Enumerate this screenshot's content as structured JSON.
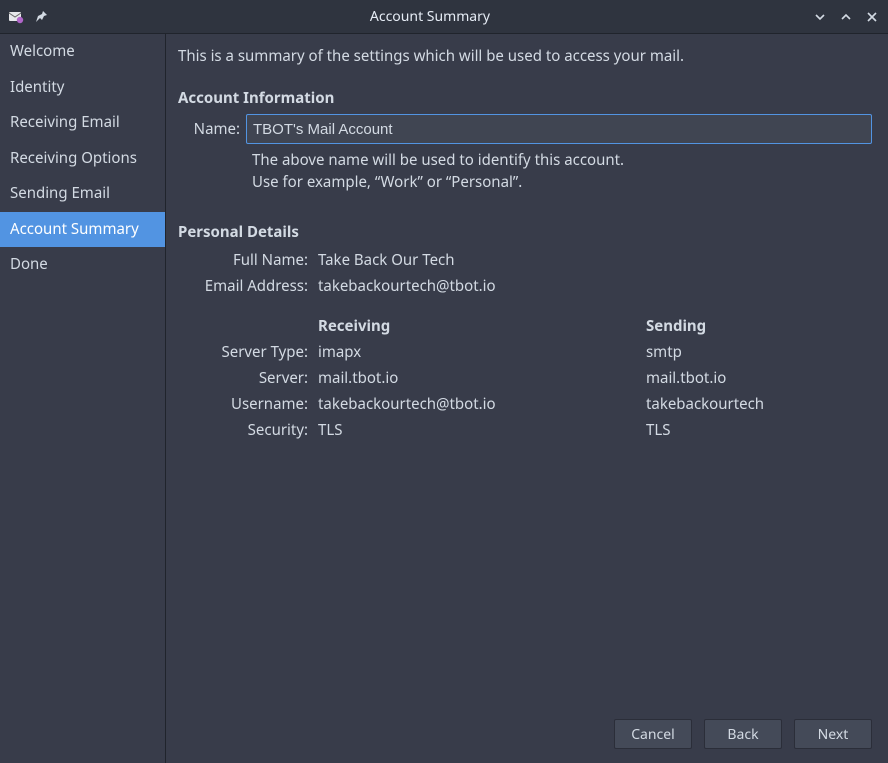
{
  "titlebar": {
    "title": "Account Summary"
  },
  "sidebar": {
    "items": [
      {
        "label": "Welcome"
      },
      {
        "label": "Identity"
      },
      {
        "label": "Receiving Email"
      },
      {
        "label": "Receiving Options"
      },
      {
        "label": "Sending Email"
      },
      {
        "label": "Account Summary"
      },
      {
        "label": "Done"
      }
    ],
    "selected_index": 5
  },
  "content": {
    "summary_text": "This is a summary of the settings which will be used to access your mail.",
    "account_info": {
      "section_title": "Account Information",
      "name_label": "Name:",
      "name_value": "TBOT's Mail Account",
      "help1": "The above name will be used to identify this account.",
      "help2": "Use for example, “Work” or “Personal”."
    },
    "personal": {
      "section_title": "Personal Details",
      "full_name_label": "Full Name:",
      "full_name_value": "Take Back Our Tech",
      "email_label": "Email Address:",
      "email_value": "takebackourtech@tbot.io"
    },
    "server": {
      "receiving_header": "Receiving",
      "sending_header": "Sending",
      "rows": [
        {
          "label": "Server Type:",
          "recv": "imapx",
          "send": "smtp"
        },
        {
          "label": "Server:",
          "recv": "mail.tbot.io",
          "send": "mail.tbot.io"
        },
        {
          "label": "Username:",
          "recv": "takebackourtech@tbot.io",
          "send": "takebackourtech"
        },
        {
          "label": "Security:",
          "recv": "TLS",
          "send": "TLS"
        }
      ]
    }
  },
  "buttons": {
    "cancel": "Cancel",
    "back": "Back",
    "next": "Next"
  }
}
